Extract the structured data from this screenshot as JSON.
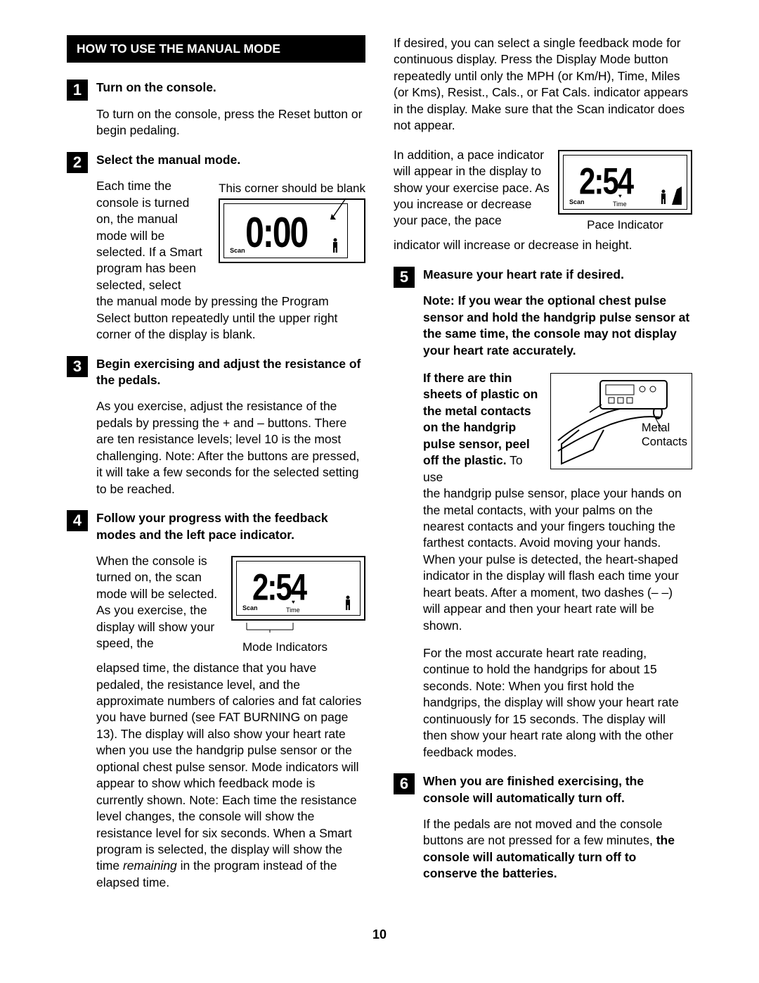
{
  "section_title": "HOW TO USE THE MANUAL MODE",
  "page_number": "10",
  "steps": {
    "s1": {
      "num": "1",
      "title": "Turn on the console.",
      "body": "To turn on the console, press the Reset button or begin pedaling."
    },
    "s2": {
      "num": "2",
      "title": "Select the manual mode.",
      "lead": "Each time the console is turned on, the manual mode will be selected. If a Smart program has been selected, select",
      "tail": "the manual mode by pressing the Program Select button repeatedly until the upper right corner of the display is blank.",
      "fig_caption": "This corner should be blank",
      "fig_readout": "0:00",
      "fig_scan": "Scan"
    },
    "s3": {
      "num": "3",
      "title": "Begin exercising and adjust the resistance of the pedals.",
      "body": "As you exercise, adjust the resistance of the pedals by pressing the + and – buttons. There are ten resistance levels; level 10 is the most challenging. Note: After the buttons are pressed, it will take a few seconds for the selected setting to be reached."
    },
    "s4": {
      "num": "4",
      "title": "Follow your progress with the feedback modes and the left pace indicator.",
      "lead": "When the console is turned on, the scan mode will be selected. As you exercise, the display will show your speed, the",
      "fig_readout": "2:54",
      "fig_scan": "Scan",
      "fig_time": "Time",
      "fig_caption": "Mode Indicators",
      "tail1": "elapsed time, the distance that you have pedaled, the resistance level, and the approximate numbers of calories and fat calories you have burned (see FAT BURNING on page 13). The display will also show your heart rate when you use the handgrip pulse sensor or the optional chest pulse sensor. Mode indicators will appear to show which feedback mode is currently shown. Note: Each time the resistance level changes, the console will show the resistance level for six seconds. When a Smart program is selected, the display will show the time ",
      "tail1_italic": "remaining",
      "tail1_end": " in the program instead of the elapsed time.",
      "para2": "If desired, you can select a single feedback mode for continuous display. Press the Display Mode button repeatedly until only the MPH (or Km/H), Time, Miles (or Kms), Resist., Cals., or Fat Cals. indicator appears in the display. Make sure that the Scan indicator does not appear.",
      "para3_lead": "In addition, a pace indicator will appear in the display to show your exercise pace. As you increase or decrease your pace, the pace",
      "para3_tail": "indicator will increase or decrease in height.",
      "fig2_caption": "Pace Indicator",
      "fig2_readout": "2:54",
      "fig2_scan": "Scan",
      "fig2_time": "Time"
    },
    "s5": {
      "num": "5",
      "title": "Measure your heart rate if desired.",
      "note": "Note: If you wear the optional chest pulse sensor and hold the handgrip pulse sensor at the same time, the console may not display your heart rate accurately.",
      "lead_bold": "If there are thin sheets of plastic on the metal contacts on the handgrip pulse sensor, peel off the plastic.",
      "lead_plain": " To use",
      "fig_label1": "Metal",
      "fig_label2": "Contacts",
      "tail": "the handgrip pulse sensor, place your hands on the metal contacts, with your palms on the nearest contacts and your fingers touching the farthest contacts. Avoid moving your hands. When your pulse is detected, the heart-shaped indicator in the display will flash each time your heart beats. After a moment, two dashes (– –) will appear and then your heart rate will be shown.",
      "para2": "For the most accurate heart rate reading, continue to hold the handgrips for about 15 seconds. Note: When you first hold the handgrips, the display will show your heart rate continuously for 15 seconds. The display will then show your heart rate along with the other feedback modes."
    },
    "s6": {
      "num": "6",
      "title": "When you are finished exercising, the console will automatically turn off.",
      "body_plain": "If the pedals are not moved and the console buttons are not pressed for a few minutes, ",
      "body_bold": "the console will automatically turn off to conserve the batteries."
    }
  }
}
